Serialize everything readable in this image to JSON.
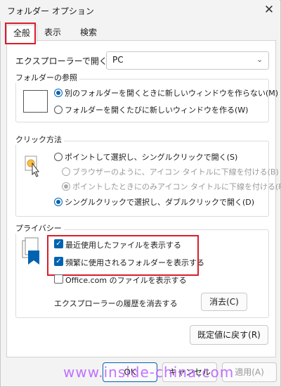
{
  "window": {
    "title": "フォルダー オプション"
  },
  "tabs": [
    {
      "label": "全般"
    },
    {
      "label": "表示"
    },
    {
      "label": "検索"
    }
  ],
  "explorer_open": {
    "label": "エクスプローラーで開く:",
    "value": "PC"
  },
  "browse_folders": {
    "title": "フォルダーの参照",
    "options": [
      "別のフォルダーを開くときに新しいウィンドウを作らない(M)",
      "フォルダーを開くたびに新しいウィンドウを作る(W)"
    ]
  },
  "click_method": {
    "title": "クリック方法",
    "options": [
      "ポイントして選択し、シングルクリックで開く(S)",
      "ブラウザーのように、アイコン タイトルに下線を付ける(B)",
      "ポイントしたときにのみアイコン タイトルに下線を付ける(P)",
      "シングルクリックで選択し、ダブルクリックで開く(D)"
    ]
  },
  "privacy": {
    "title": "プライバシー",
    "checks": [
      "最近使用したファイルを表示する",
      "頻繁に使用されるフォルダーを表示する",
      "Office.com のファイルを表示する"
    ],
    "clear_label": "エクスプローラーの履歴を消去する",
    "clear_button": "消去(C)"
  },
  "buttons": {
    "restore_defaults": "既定値に戻す(R)",
    "ok": "OK",
    "cancel": "キャンセル",
    "apply": "適用(A)"
  },
  "watermark": "www.inside-china.com",
  "colors": {
    "accent": "#0063b1",
    "highlight_box": "#d81e2b",
    "watermark": "#b85cff"
  }
}
